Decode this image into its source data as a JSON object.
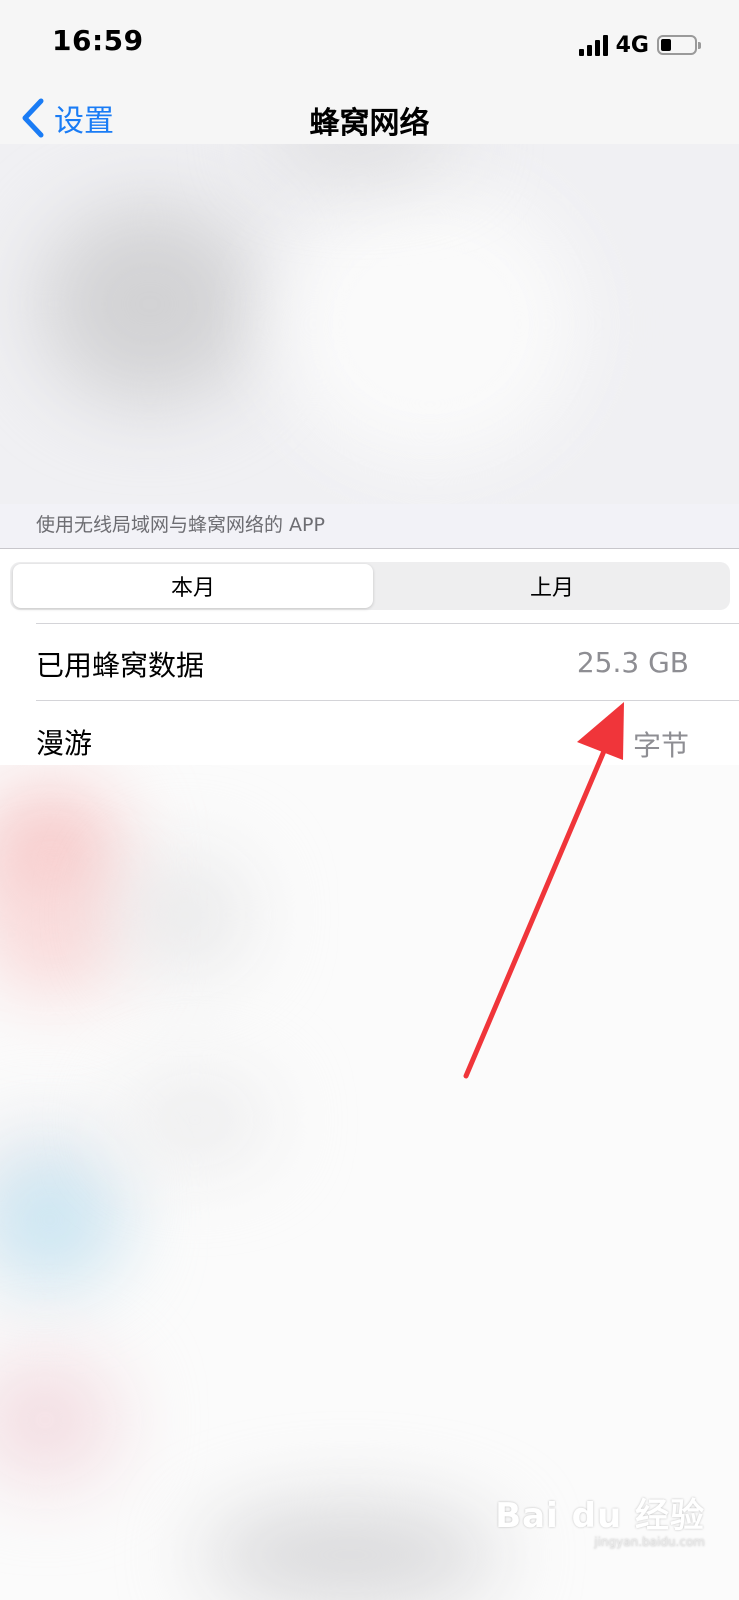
{
  "status_bar": {
    "time": "16:59",
    "network": "4G",
    "icons": [
      "signal-bars-icon",
      "battery-icon"
    ]
  },
  "nav": {
    "back_label": "设置",
    "title": "蜂窝网络",
    "back_icon": "chevron-left-icon"
  },
  "apps_section": {
    "footer": "使用无线局域网与蜂窝网络的 APP"
  },
  "period_selector": {
    "options": [
      "本月",
      "上月"
    ],
    "selected": "本月"
  },
  "usage_rows": [
    {
      "label": "已用蜂窝数据",
      "value": "25.3 GB"
    },
    {
      "label": "漫游",
      "value": "0 字节"
    }
  ],
  "watermark": {
    "main": "Bai du 经验",
    "sub": "jingyan.baidu.com"
  },
  "colors": {
    "accent": "#1a7cf5",
    "annotation_arrow": "#f0353a",
    "secondary_text": "#8e8e93"
  }
}
